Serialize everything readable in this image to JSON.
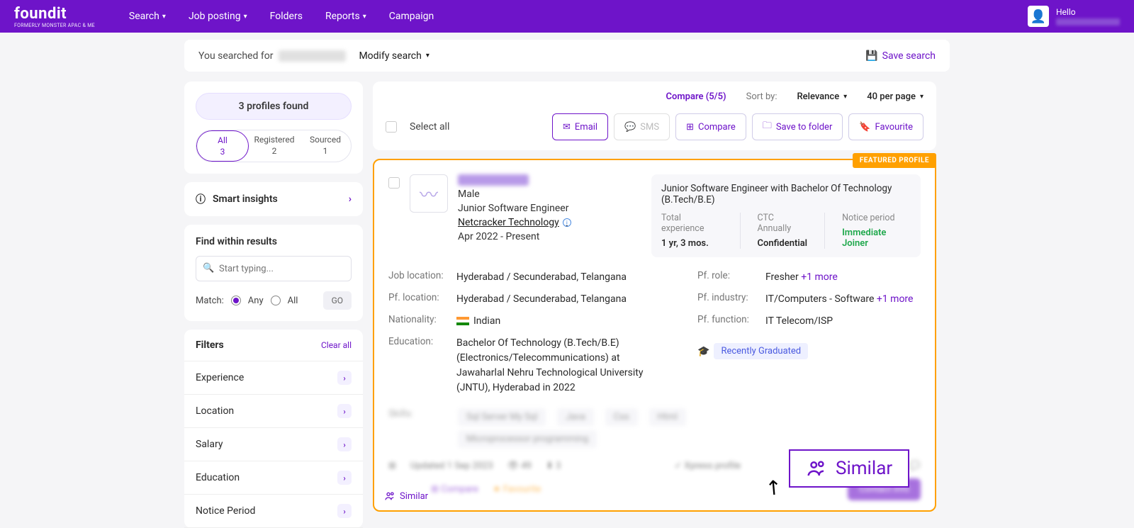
{
  "header": {
    "logo": "foundit",
    "logo_sub": "FORMERLY MONSTER APAC & ME",
    "nav": [
      "Search",
      "Job posting",
      "Folders",
      "Reports",
      "Campaign"
    ],
    "nav_has_chevron": [
      true,
      true,
      false,
      true,
      false
    ],
    "user_hello": "Hello"
  },
  "searchBar": {
    "prefix": "You searched for",
    "modify": "Modify search",
    "save": "Save search"
  },
  "sidebar": {
    "profiles_found": "3 profiles found",
    "tabs": [
      {
        "label": "All",
        "count": "3"
      },
      {
        "label": "Registered",
        "count": "2"
      },
      {
        "label": "Sourced",
        "count": "1"
      }
    ],
    "insights": "Smart insights",
    "find_title": "Find within results",
    "find_placeholder": "Start typing...",
    "match_label": "Match:",
    "match_any": "Any",
    "match_all": "All",
    "go": "GO",
    "filters_title": "Filters",
    "clear_all": "Clear all",
    "filters": [
      "Experience",
      "Location",
      "Salary",
      "Education",
      "Notice Period"
    ]
  },
  "toolbar": {
    "compare": "Compare (5/5)",
    "sort_label": "Sort by:",
    "sort_value": "Relevance",
    "per_page": "40 per page",
    "select_all": "Select all",
    "email": "Email",
    "sms": "SMS",
    "compare_btn": "Compare",
    "save_folder": "Save to folder",
    "favourite": "Favourite"
  },
  "profile": {
    "featured": "FEATURED PROFILE",
    "gender": "Male",
    "title": "Junior Software Engineer",
    "company": "Netcracker Technology",
    "dates": "Apr 2022 - Present",
    "right_title": "Junior Software Engineer with Bachelor Of Technology (B.Tech/B.E)",
    "stats": {
      "exp_label": "Total experience",
      "exp_val": "1 yr, 3 mos.",
      "ctc_label": "CTC Annually",
      "ctc_val": "Confidential",
      "notice_label": "Notice period",
      "notice_val": "Immediate Joiner"
    },
    "det_left": {
      "jobloc_l": "Job location:",
      "jobloc_v": "Hyderabad / Secunderabad, Telangana",
      "pfloc_l": "Pf. location:",
      "pfloc_v": "Hyderabad / Secunderabad, Telangana",
      "nat_l": "Nationality:",
      "nat_v": "Indian",
      "edu_l": "Education:",
      "edu_v": "Bachelor Of Technology (B.Tech/B.E) (Electronics/Telecommunications) at Jawaharlal Nehru Technological University (JNTU), Hyderabad in 2022"
    },
    "det_right": {
      "role_l": "Pf. role:",
      "role_v": "Fresher",
      "role_more": "+1 more",
      "ind_l": "Pf. industry:",
      "ind_v": "IT/Computers - Software",
      "ind_more": "+1 more",
      "func_l": "Pf. function:",
      "func_v": "IT Telecom/ISP"
    },
    "rec_grad": "Recently Graduated",
    "similar_link": "Similar",
    "callout": "Similar",
    "contact": "Contact info"
  }
}
